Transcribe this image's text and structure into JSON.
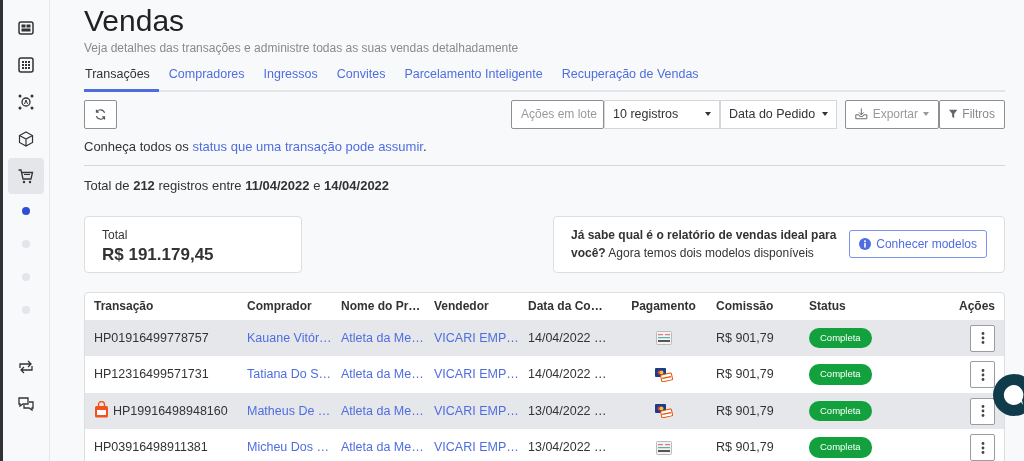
{
  "sidebar": {
    "items": [
      {
        "kind": "icon",
        "selected": false
      },
      {
        "kind": "icon",
        "selected": false
      },
      {
        "kind": "icon",
        "selected": false
      },
      {
        "kind": "icon",
        "selected": false
      },
      {
        "kind": "icon",
        "selected": true
      },
      {
        "kind": "dot",
        "selected": true
      },
      {
        "kind": "dot",
        "selected": false
      },
      {
        "kind": "dot",
        "selected": false
      },
      {
        "kind": "dot",
        "selected": false
      },
      {
        "kind": "icon",
        "selected": false
      },
      {
        "kind": "icon",
        "selected": false
      }
    ]
  },
  "header": {
    "title": "Vendas",
    "subtitle": "Veja detalhes das transações e administre todas as suas vendas detalhadamente"
  },
  "tabs": [
    {
      "label": "Transações",
      "selected": true
    },
    {
      "label": "Compradores",
      "selected": false
    },
    {
      "label": "Ingressos",
      "selected": false
    },
    {
      "label": "Convites",
      "selected": false
    },
    {
      "label": "Parcelamento Inteligente",
      "selected": false
    },
    {
      "label": "Recuperação de Vendas",
      "selected": false
    }
  ],
  "toolbar": {
    "bulk_actions": {
      "label": "Ações em lote",
      "disabled": true
    },
    "page_size": "10 registros",
    "date_field": "Data do Pedido",
    "export": {
      "label": "Exportar",
      "disabled": true
    },
    "filters": "Filtros"
  },
  "status_info": {
    "text": "Conheça todos os ",
    "link": "status que uma transação pode assumir",
    "end": "."
  },
  "summary": "Total de **212** registros entre **11/04/2022** e **14/04/2022**",
  "total_card": {
    "label": "Total",
    "value": "R$ 191.179,45"
  },
  "report_card": {
    "text": "**Já sabe qual é o relatório de vendas ideal para você?** Agora temos dois modelos disponíveis",
    "button": "Conhecer modelos"
  },
  "table": {
    "columns": [
      "Transação",
      "Comprador",
      "Nome do Pr…",
      "Vendedor",
      "Data da Co…",
      "Pagamento",
      "Comissão",
      "Status",
      "Ações"
    ],
    "rows": [
      {
        "transaction": "HP01916499778757",
        "bag_icon": false,
        "buyer": "Kauane Vitór…",
        "product": "Atleta da Me…",
        "seller": "VICARI EMP…",
        "date": "14/04/2022 …",
        "payment": {
          "kind": "slip"
        },
        "commission": "R$ 901,79",
        "status": "Completa"
      },
      {
        "transaction": "HP12316499571731",
        "bag_icon": false,
        "buyer": "Tatiana Do S…",
        "product": "Atleta da Me…",
        "seller": "VICARI EMP…",
        "date": "14/04/2022 …",
        "payment": {
          "kind": "card"
        },
        "commission": "R$ 901,79",
        "status": "Completa"
      },
      {
        "transaction": "HP19916498948160",
        "bag_icon": true,
        "buyer": "Matheus De …",
        "product": "Atleta da Me…",
        "seller": "VICARI EMP…",
        "date": "13/04/2022 …",
        "payment": {
          "kind": "card"
        },
        "commission": "R$ 901,79",
        "status": "Completa"
      },
      {
        "transaction": "HP03916498911381",
        "bag_icon": false,
        "buyer": "Micheu Dos …",
        "product": "Atleta da Me…",
        "seller": "VICARI EMP…",
        "date": "13/04/2022 …",
        "payment": {
          "kind": "slip"
        },
        "commission": "R$ 901,79",
        "status": "Completa"
      }
    ]
  }
}
